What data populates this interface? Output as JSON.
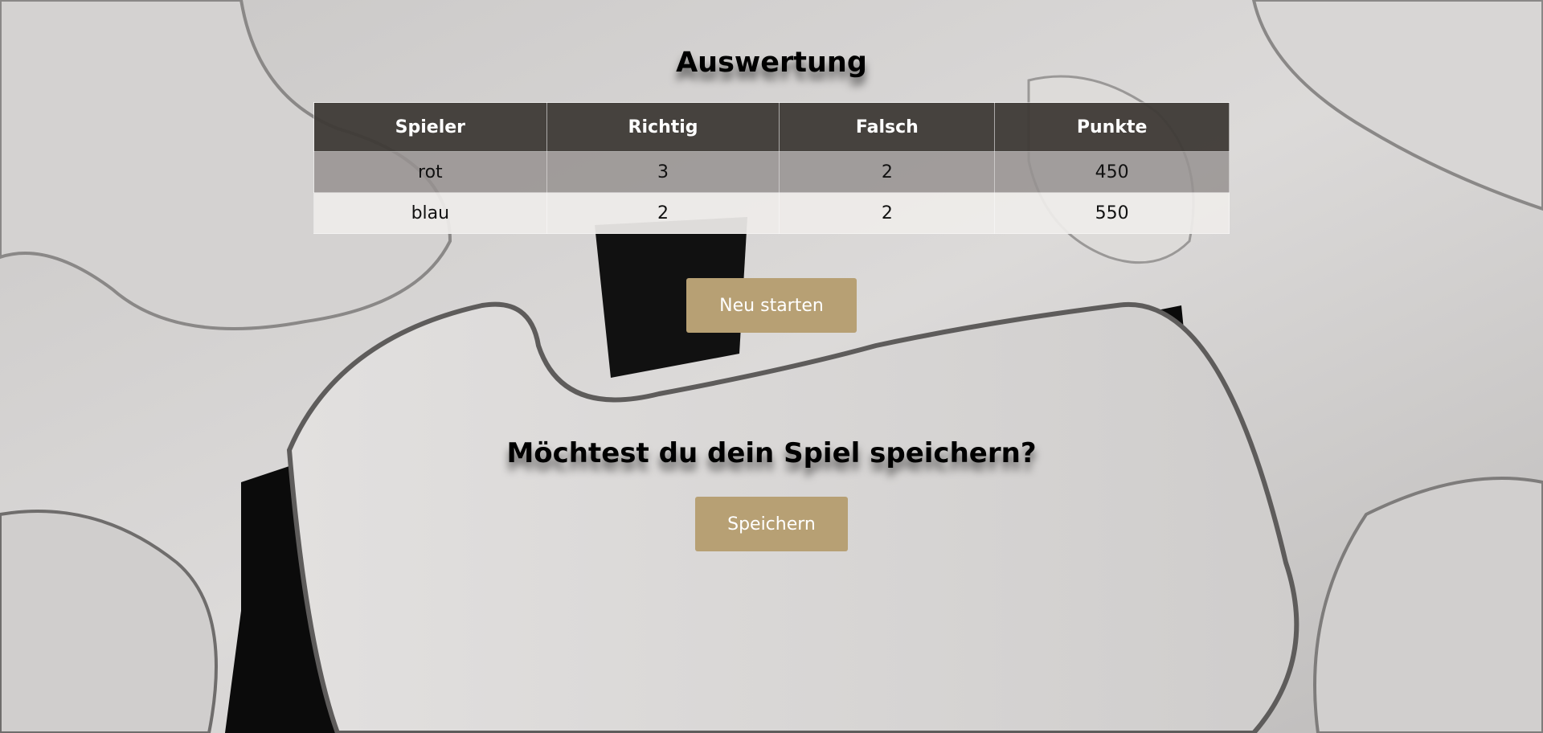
{
  "page": {
    "title": "Auswertung"
  },
  "results_table": {
    "headers": [
      "Spieler",
      "Richtig",
      "Falsch",
      "Punkte"
    ],
    "rows": [
      [
        "rot",
        "3",
        "2",
        "450"
      ],
      [
        "blau",
        "2",
        "2",
        "550"
      ]
    ]
  },
  "actions": {
    "restart_label": "Neu starten",
    "save_question": "Möchtest du dein Spiel speichern?",
    "save_label": "Speichern"
  },
  "colors": {
    "button": "#b7a074",
    "table_header": "#3e3a36"
  },
  "background": {
    "icon": "jigsaw-puzzle-background-image"
  }
}
